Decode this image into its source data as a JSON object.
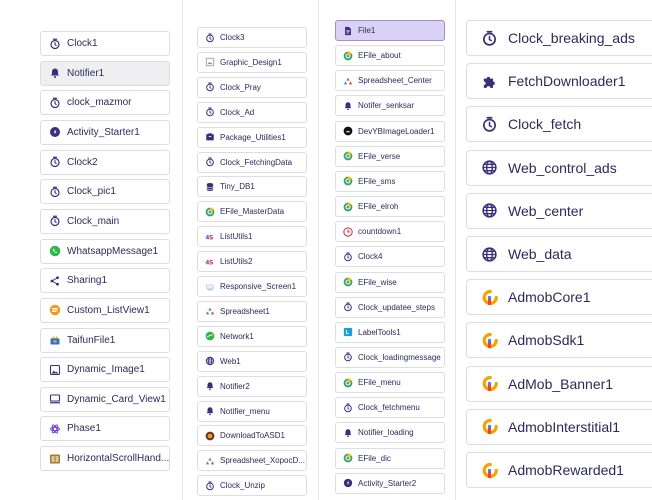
{
  "columns": [
    {
      "items": [
        {
          "label": "Clock1",
          "icon": "clock-icon"
        },
        {
          "label": "Notifier1",
          "icon": "bell-icon",
          "selected": true
        },
        {
          "label": "clock_mazmor",
          "icon": "clock-icon"
        },
        {
          "label": "Activity_Starter1",
          "icon": "rocket-icon"
        },
        {
          "label": "Clock2",
          "icon": "clock-icon"
        },
        {
          "label": "Clock_pic1",
          "icon": "clock-icon"
        },
        {
          "label": "Clock_main",
          "icon": "clock-icon"
        },
        {
          "label": "WhatsappMessage1",
          "icon": "whatsapp-icon"
        },
        {
          "label": "Sharing1",
          "icon": "share-icon"
        },
        {
          "label": "Custom_ListView1",
          "icon": "listview-icon"
        },
        {
          "label": "TaifunFile1",
          "icon": "taifun-icon"
        },
        {
          "label": "Dynamic_Image1",
          "icon": "image-icon"
        },
        {
          "label": "Dynamic_Card_View1",
          "icon": "card-icon"
        },
        {
          "label": "Phase1",
          "icon": "phase-icon"
        },
        {
          "label": "HorizontalScrollHand...",
          "icon": "scroll-icon"
        }
      ]
    },
    {
      "items": [
        {
          "label": "Clock3",
          "icon": "clock-icon"
        },
        {
          "label": "Graphic_Design1",
          "icon": "graphic-icon"
        },
        {
          "label": "Clock_Pray",
          "icon": "clock-icon"
        },
        {
          "label": "Clock_Ad",
          "icon": "clock-icon"
        },
        {
          "label": "Package_Utilities1",
          "icon": "package-icon"
        },
        {
          "label": "Clock_FetchingData",
          "icon": "clock-icon"
        },
        {
          "label": "Tiny_DB1",
          "icon": "database-icon"
        },
        {
          "label": "EFile_MasterData",
          "icon": "efile-icon"
        },
        {
          "label": "ListUtils1",
          "icon": "listutils-icon"
        },
        {
          "label": "ListUtils2",
          "icon": "listutils-icon"
        },
        {
          "label": "Responsive_Screen1",
          "icon": "responsive-icon"
        },
        {
          "label": "Spreadsheet1",
          "icon": "spreadsheet-icon"
        },
        {
          "label": "Network1",
          "icon": "network-icon"
        },
        {
          "label": "Web1",
          "icon": "globe-icon"
        },
        {
          "label": "Notifier2",
          "icon": "bell-icon"
        },
        {
          "label": "Notifier_menu",
          "icon": "bell-icon"
        },
        {
          "label": "DownloadToASD1",
          "icon": "download-icon"
        },
        {
          "label": "Spreadsheet_XopocD...",
          "icon": "spreadsheet-icon"
        },
        {
          "label": "Clock_Unzip",
          "icon": "clock-icon"
        }
      ]
    },
    {
      "items": [
        {
          "label": "File1",
          "icon": "file-icon",
          "highlighted": true
        },
        {
          "label": "EFile_about",
          "icon": "efile-icon"
        },
        {
          "label": "Spreadsheet_Center",
          "icon": "spreadsheet-icon"
        },
        {
          "label": "Notifer_senksar",
          "icon": "bell-icon"
        },
        {
          "label": "DevYBImageLoader1",
          "icon": "imageloader-icon"
        },
        {
          "label": "EFile_verse",
          "icon": "efile-icon"
        },
        {
          "label": "EFile_sms",
          "icon": "efile-icon"
        },
        {
          "label": "EFile_elroh",
          "icon": "efile-icon"
        },
        {
          "label": "countdown1",
          "icon": "countdown-icon"
        },
        {
          "label": "Clock4",
          "icon": "clock-icon"
        },
        {
          "label": "EFile_wise",
          "icon": "efile-icon"
        },
        {
          "label": "Clock_updatee_steps",
          "icon": "clock-icon"
        },
        {
          "label": "LabelTools1",
          "icon": "labeltools-icon"
        },
        {
          "label": "Clock_loadingmessage",
          "icon": "clock-icon"
        },
        {
          "label": "EFile_menu",
          "icon": "efile-icon"
        },
        {
          "label": "Clock_fetchmenu",
          "icon": "clock-icon"
        },
        {
          "label": "Notifier_loading",
          "icon": "bell-icon"
        },
        {
          "label": "EFile_dic",
          "icon": "efile-icon"
        },
        {
          "label": "Activity_Starter2",
          "icon": "rocket-icon"
        }
      ]
    },
    {
      "items": [
        {
          "label": "Clock_breaking_ads",
          "icon": "clock-icon"
        },
        {
          "label": "FetchDownloader1",
          "icon": "puzzle-icon"
        },
        {
          "label": "Clock_fetch",
          "icon": "clock-icon"
        },
        {
          "label": "Web_control_ads",
          "icon": "globe-icon"
        },
        {
          "label": "Web_center",
          "icon": "globe-icon"
        },
        {
          "label": "Web_data",
          "icon": "globe-icon"
        },
        {
          "label": "AdmobCore1",
          "icon": "admob-icon"
        },
        {
          "label": "AdmobSdk1",
          "icon": "admob-icon"
        },
        {
          "label": "AdMob_Banner1",
          "icon": "admob-icon"
        },
        {
          "label": "AdmobInterstitial1",
          "icon": "admob-icon"
        },
        {
          "label": "AdmobRewarded1",
          "icon": "admob-icon"
        }
      ]
    }
  ],
  "colors": {
    "text": "#2d2a5a",
    "icon": "#3a2f7a",
    "selected_bg": "#efeff2",
    "highlight_bg": "#d9d2f5",
    "border": "#dcdde3"
  }
}
